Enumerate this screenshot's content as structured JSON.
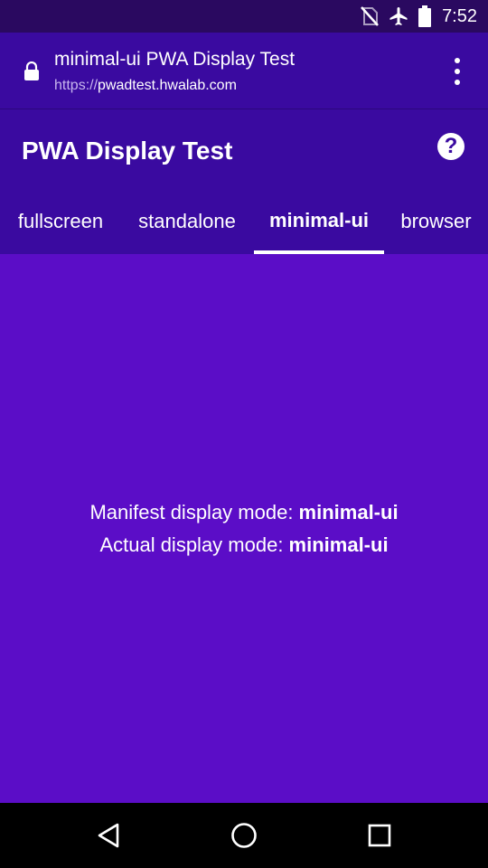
{
  "status_bar": {
    "time": "7:52",
    "icons": [
      "no-sim-icon",
      "airplane-mode-icon",
      "battery-icon"
    ]
  },
  "browser": {
    "page_title": "minimal-ui PWA Display Test",
    "url_scheme": "https://",
    "url_host": "pwadtest.hwalab.com",
    "lock_icon": "lock-icon",
    "menu_icon": "overflow-menu-icon"
  },
  "app": {
    "title": "PWA Display Test",
    "help_icon": "help-icon",
    "help_glyph": "?",
    "tabs": [
      {
        "label": "fullscreen",
        "active": false
      },
      {
        "label": "standalone",
        "active": false
      },
      {
        "label": "minimal-ui",
        "active": true
      },
      {
        "label": "browser",
        "active": false
      }
    ]
  },
  "content": {
    "manifest_label": "Manifest display mode: ",
    "manifest_value": "minimal-ui",
    "actual_label": "Actual display mode: ",
    "actual_value": "minimal-ui"
  },
  "nav": {
    "back_icon": "back-icon",
    "home_icon": "home-icon",
    "recents_icon": "recents-icon"
  },
  "colors": {
    "status_bar": "#2a0960",
    "app_bar": "#3a0aa0",
    "content": "#5b0dc7",
    "nav_bar": "#000000"
  }
}
